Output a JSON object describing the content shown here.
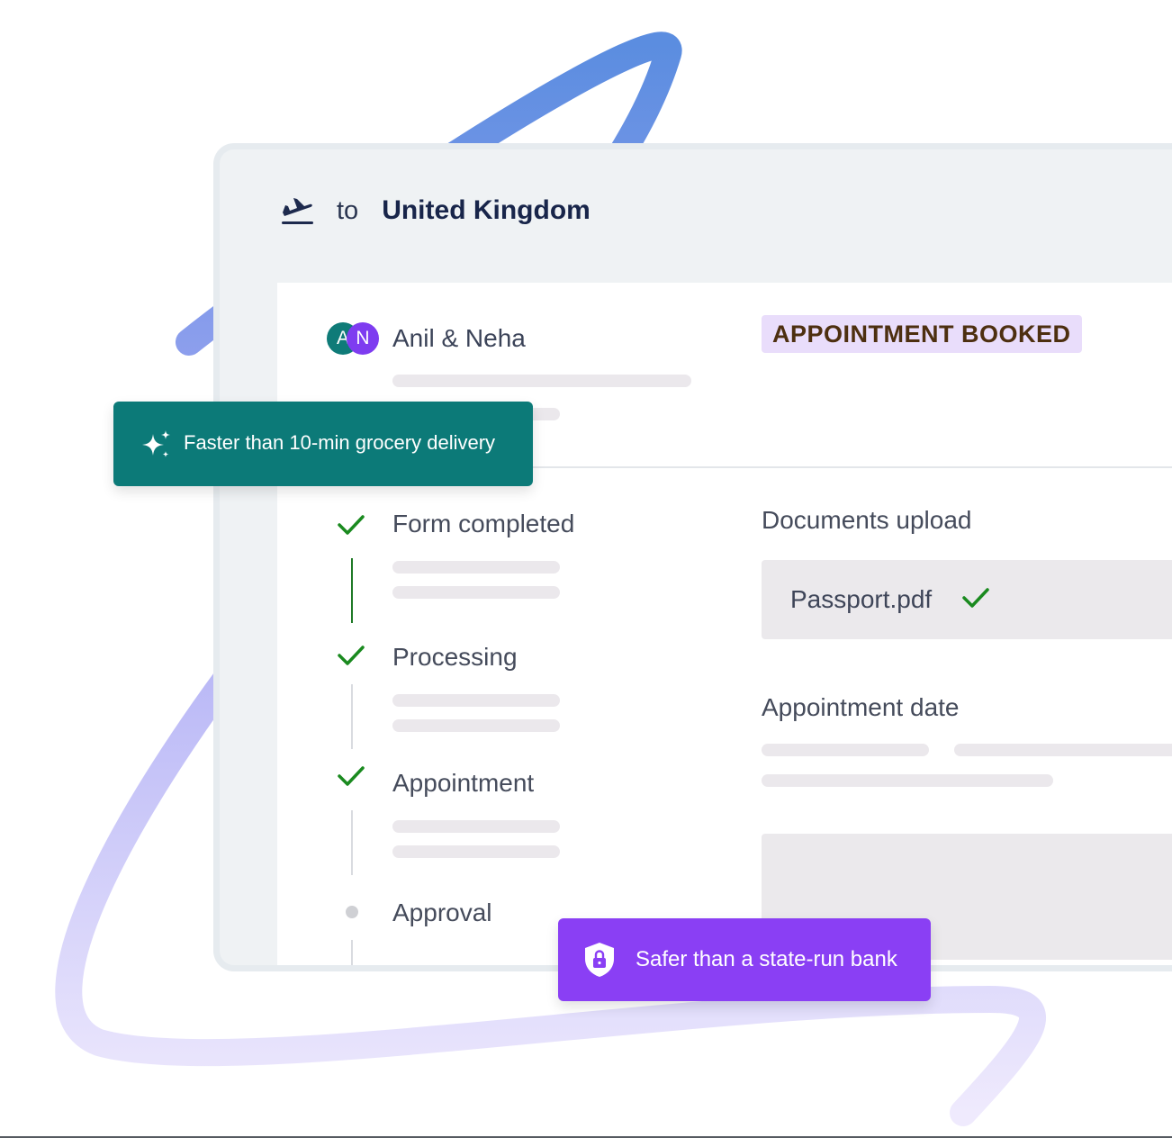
{
  "header": {
    "to_label": "to",
    "destination": "United Kingdom",
    "icon": "plane-takeoff-icon"
  },
  "applicants": {
    "avatar_initials": [
      "A",
      "N"
    ],
    "names": "Anil & Neha"
  },
  "status": {
    "label": "APPOINTMENT BOOKED"
  },
  "steps": [
    {
      "label": "Form completed",
      "state": "done"
    },
    {
      "label": "Processing",
      "state": "done"
    },
    {
      "label": "Appointment",
      "state": "done"
    },
    {
      "label": "Approval",
      "state": "pending"
    }
  ],
  "documents": {
    "title": "Documents upload",
    "file": "Passport.pdf",
    "file_state": "uploaded"
  },
  "appointment": {
    "title": "Appointment date"
  },
  "badges": {
    "speed": {
      "text": "Faster than 10-min grocery delivery",
      "icon": "sparkle-icon"
    },
    "safety": {
      "text": "Safer than a state-run bank",
      "icon": "shield-lock-icon"
    }
  },
  "colors": {
    "accent_green": "#0c7a78",
    "accent_purple": "#8a3ff4",
    "check_green": "#1a8a1f",
    "badge_bg": "#e9ddfb",
    "orbit_top": "#5b8de0",
    "orbit_bottom": "#e6defd"
  }
}
